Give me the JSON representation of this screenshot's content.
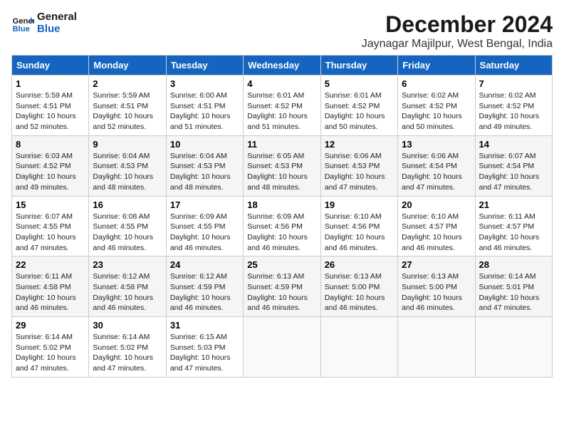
{
  "logo": {
    "line1": "General",
    "line2": "Blue"
  },
  "title": "December 2024",
  "subtitle": "Jaynagar Majilpur, West Bengal, India",
  "columns": [
    "Sunday",
    "Monday",
    "Tuesday",
    "Wednesday",
    "Thursday",
    "Friday",
    "Saturday"
  ],
  "weeks": [
    [
      {
        "day": "1",
        "sunrise": "Sunrise: 5:59 AM",
        "sunset": "Sunset: 4:51 PM",
        "daylight": "Daylight: 10 hours and 52 minutes."
      },
      {
        "day": "2",
        "sunrise": "Sunrise: 5:59 AM",
        "sunset": "Sunset: 4:51 PM",
        "daylight": "Daylight: 10 hours and 52 minutes."
      },
      {
        "day": "3",
        "sunrise": "Sunrise: 6:00 AM",
        "sunset": "Sunset: 4:51 PM",
        "daylight": "Daylight: 10 hours and 51 minutes."
      },
      {
        "day": "4",
        "sunrise": "Sunrise: 6:01 AM",
        "sunset": "Sunset: 4:52 PM",
        "daylight": "Daylight: 10 hours and 51 minutes."
      },
      {
        "day": "5",
        "sunrise": "Sunrise: 6:01 AM",
        "sunset": "Sunset: 4:52 PM",
        "daylight": "Daylight: 10 hours and 50 minutes."
      },
      {
        "day": "6",
        "sunrise": "Sunrise: 6:02 AM",
        "sunset": "Sunset: 4:52 PM",
        "daylight": "Daylight: 10 hours and 50 minutes."
      },
      {
        "day": "7",
        "sunrise": "Sunrise: 6:02 AM",
        "sunset": "Sunset: 4:52 PM",
        "daylight": "Daylight: 10 hours and 49 minutes."
      }
    ],
    [
      {
        "day": "8",
        "sunrise": "Sunrise: 6:03 AM",
        "sunset": "Sunset: 4:52 PM",
        "daylight": "Daylight: 10 hours and 49 minutes."
      },
      {
        "day": "9",
        "sunrise": "Sunrise: 6:04 AM",
        "sunset": "Sunset: 4:53 PM",
        "daylight": "Daylight: 10 hours and 48 minutes."
      },
      {
        "day": "10",
        "sunrise": "Sunrise: 6:04 AM",
        "sunset": "Sunset: 4:53 PM",
        "daylight": "Daylight: 10 hours and 48 minutes."
      },
      {
        "day": "11",
        "sunrise": "Sunrise: 6:05 AM",
        "sunset": "Sunset: 4:53 PM",
        "daylight": "Daylight: 10 hours and 48 minutes."
      },
      {
        "day": "12",
        "sunrise": "Sunrise: 6:06 AM",
        "sunset": "Sunset: 4:53 PM",
        "daylight": "Daylight: 10 hours and 47 minutes."
      },
      {
        "day": "13",
        "sunrise": "Sunrise: 6:06 AM",
        "sunset": "Sunset: 4:54 PM",
        "daylight": "Daylight: 10 hours and 47 minutes."
      },
      {
        "day": "14",
        "sunrise": "Sunrise: 6:07 AM",
        "sunset": "Sunset: 4:54 PM",
        "daylight": "Daylight: 10 hours and 47 minutes."
      }
    ],
    [
      {
        "day": "15",
        "sunrise": "Sunrise: 6:07 AM",
        "sunset": "Sunset: 4:55 PM",
        "daylight": "Daylight: 10 hours and 47 minutes."
      },
      {
        "day": "16",
        "sunrise": "Sunrise: 6:08 AM",
        "sunset": "Sunset: 4:55 PM",
        "daylight": "Daylight: 10 hours and 46 minutes."
      },
      {
        "day": "17",
        "sunrise": "Sunrise: 6:09 AM",
        "sunset": "Sunset: 4:55 PM",
        "daylight": "Daylight: 10 hours and 46 minutes."
      },
      {
        "day": "18",
        "sunrise": "Sunrise: 6:09 AM",
        "sunset": "Sunset: 4:56 PM",
        "daylight": "Daylight: 10 hours and 46 minutes."
      },
      {
        "day": "19",
        "sunrise": "Sunrise: 6:10 AM",
        "sunset": "Sunset: 4:56 PM",
        "daylight": "Daylight: 10 hours and 46 minutes."
      },
      {
        "day": "20",
        "sunrise": "Sunrise: 6:10 AM",
        "sunset": "Sunset: 4:57 PM",
        "daylight": "Daylight: 10 hours and 46 minutes."
      },
      {
        "day": "21",
        "sunrise": "Sunrise: 6:11 AM",
        "sunset": "Sunset: 4:57 PM",
        "daylight": "Daylight: 10 hours and 46 minutes."
      }
    ],
    [
      {
        "day": "22",
        "sunrise": "Sunrise: 6:11 AM",
        "sunset": "Sunset: 4:58 PM",
        "daylight": "Daylight: 10 hours and 46 minutes."
      },
      {
        "day": "23",
        "sunrise": "Sunrise: 6:12 AM",
        "sunset": "Sunset: 4:58 PM",
        "daylight": "Daylight: 10 hours and 46 minutes."
      },
      {
        "day": "24",
        "sunrise": "Sunrise: 6:12 AM",
        "sunset": "Sunset: 4:59 PM",
        "daylight": "Daylight: 10 hours and 46 minutes."
      },
      {
        "day": "25",
        "sunrise": "Sunrise: 6:13 AM",
        "sunset": "Sunset: 4:59 PM",
        "daylight": "Daylight: 10 hours and 46 minutes."
      },
      {
        "day": "26",
        "sunrise": "Sunrise: 6:13 AM",
        "sunset": "Sunset: 5:00 PM",
        "daylight": "Daylight: 10 hours and 46 minutes."
      },
      {
        "day": "27",
        "sunrise": "Sunrise: 6:13 AM",
        "sunset": "Sunset: 5:00 PM",
        "daylight": "Daylight: 10 hours and 46 minutes."
      },
      {
        "day": "28",
        "sunrise": "Sunrise: 6:14 AM",
        "sunset": "Sunset: 5:01 PM",
        "daylight": "Daylight: 10 hours and 47 minutes."
      }
    ],
    [
      {
        "day": "29",
        "sunrise": "Sunrise: 6:14 AM",
        "sunset": "Sunset: 5:02 PM",
        "daylight": "Daylight: 10 hours and 47 minutes."
      },
      {
        "day": "30",
        "sunrise": "Sunrise: 6:14 AM",
        "sunset": "Sunset: 5:02 PM",
        "daylight": "Daylight: 10 hours and 47 minutes."
      },
      {
        "day": "31",
        "sunrise": "Sunrise: 6:15 AM",
        "sunset": "Sunset: 5:03 PM",
        "daylight": "Daylight: 10 hours and 47 minutes."
      },
      null,
      null,
      null,
      null
    ]
  ]
}
